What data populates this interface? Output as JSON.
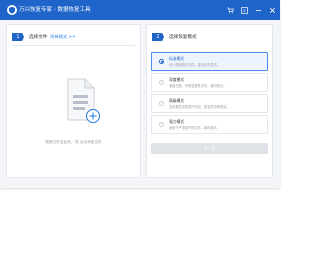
{
  "titlebar": {
    "app_title": "万兴恢复专家 - 数据恢复工具",
    "accent": "#1f64c9",
    "icons": [
      "cart-icon",
      "account-icon",
      "minimize-icon",
      "close-icon"
    ]
  },
  "left_panel": {
    "step_number": "1",
    "step_title": "选择文件",
    "link_text": "所有格式 >>",
    "empty_hint": "拖拽文件至此处，或 点击添加文件"
  },
  "right_panel": {
    "step_number": "2",
    "step_title": "选择恢复模式",
    "options": [
      {
        "title": "标准模式",
        "desc": "可以快速恢复文件，建议优先尝试。",
        "selected": true
      },
      {
        "title": "深度模式",
        "desc": "深度扫描，可恢复更多文件，耗时较长。",
        "selected": false
      },
      {
        "title": "高级模式",
        "desc": "支持更复杂的损坏情况，恢复成功率更高。",
        "selected": false
      },
      {
        "title": "强力模式",
        "desc": "适用于严重损坏的文件，耗时最长。",
        "selected": false
      }
    ],
    "next_button": "下一步"
  }
}
